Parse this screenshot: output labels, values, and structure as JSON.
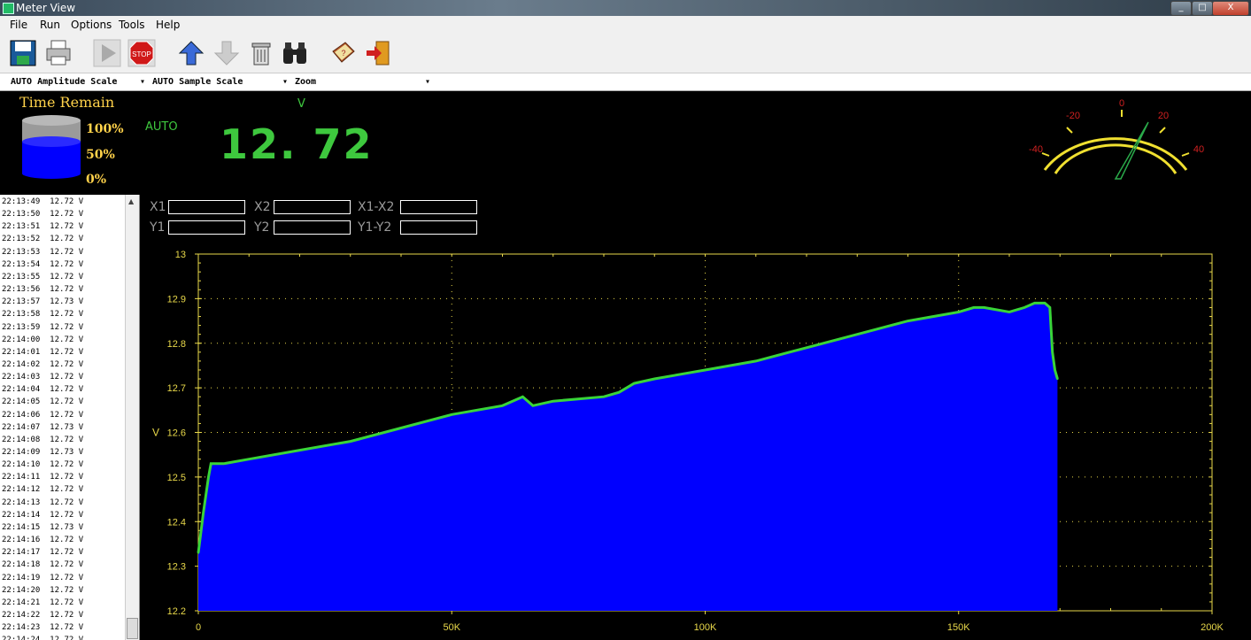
{
  "window": {
    "title": "Meter View",
    "min": "_",
    "max": "□",
    "close": "X"
  },
  "menu": [
    "File",
    "Run",
    "Options",
    "Tools",
    "Help"
  ],
  "toolbar": {
    "buttons": [
      "save-icon",
      "print-icon",
      "play-icon",
      "stop-icon",
      "scroll-up-icon",
      "scroll-down-icon",
      "trash-icon",
      "binoculars-icon",
      "help-book-icon",
      "exit-icon"
    ],
    "stop_label": "STOP"
  },
  "combos": {
    "amplitude": "AUTO Amplitude Scale",
    "sample": "AUTO Sample Scale",
    "zoom": "Zoom"
  },
  "panel": {
    "time_remain_label": "Time Remain",
    "pct_100": "100%",
    "pct_50": "50%",
    "pct_0": "0%",
    "auto": "AUTO",
    "unit": "V",
    "reading": "12. 72",
    "time_remain_fraction": 0.6
  },
  "gauge": {
    "ticks": [
      "-40",
      "-20",
      "0",
      "20",
      "40"
    ],
    "needle_value": 12.72
  },
  "log": [
    "22:13:49  12.72 V",
    "22:13:50  12.72 V",
    "22:13:51  12.72 V",
    "22:13:52  12.72 V",
    "22:13:53  12.72 V",
    "22:13:54  12.72 V",
    "22:13:55  12.72 V",
    "22:13:56  12.72 V",
    "22:13:57  12.73 V",
    "22:13:58  12.72 V",
    "22:13:59  12.72 V",
    "22:14:00  12.72 V",
    "22:14:01  12.72 V",
    "22:14:02  12.72 V",
    "22:14:03  12.72 V",
    "22:14:04  12.72 V",
    "22:14:05  12.72 V",
    "22:14:06  12.72 V",
    "22:14:07  12.73 V",
    "22:14:08  12.72 V",
    "22:14:09  12.73 V",
    "22:14:10  12.72 V",
    "22:14:11  12.72 V",
    "22:14:12  12.72 V",
    "22:14:13  12.72 V",
    "22:14:14  12.72 V",
    "22:14:15  12.73 V",
    "22:14:16  12.72 V",
    "22:14:17  12.72 V",
    "22:14:18  12.72 V",
    "22:14:19  12.72 V",
    "22:14:20  12.72 V",
    "22:14:21  12.72 V",
    "22:14:22  12.72 V",
    "22:14:23  12.72 V",
    "22:14:24  12.72 V"
  ],
  "cursors": {
    "x1": "X1",
    "x2": "X2",
    "dx": "X1-X2",
    "y1": "Y1",
    "y2": "Y2",
    "dy": "Y1-Y2"
  },
  "colors": {
    "trace": "#39d439",
    "fill": "#0000ff",
    "axis": "#e8d84a",
    "digits": "#3ec83e",
    "labels": "#ffd24a"
  },
  "chart_data": {
    "type": "area",
    "ylabel": "V",
    "xlabel": "Sample Number",
    "ylim": [
      12.2,
      13
    ],
    "xlim": [
      0,
      200000
    ],
    "yticks": [
      "13",
      "12.9",
      "12.8",
      "12.7",
      "12.6",
      "12.5",
      "12.4",
      "12.3",
      "12.2"
    ],
    "xticks": [
      "0",
      "50K",
      "100K",
      "150K",
      "200K"
    ],
    "grid": true,
    "x": [
      0,
      1000,
      2000,
      2500,
      5000,
      10000,
      20000,
      30000,
      40000,
      50000,
      60000,
      64000,
      66000,
      70000,
      80000,
      83000,
      86000,
      90000,
      100000,
      110000,
      120000,
      130000,
      140000,
      150000,
      153000,
      155000,
      160000,
      163000,
      165000,
      167000,
      168000,
      168500,
      169000,
      169500
    ],
    "y": [
      12.33,
      12.42,
      12.5,
      12.53,
      12.53,
      12.54,
      12.56,
      12.58,
      12.61,
      12.64,
      12.66,
      12.68,
      12.66,
      12.67,
      12.68,
      12.69,
      12.71,
      12.72,
      12.74,
      12.76,
      12.79,
      12.82,
      12.85,
      12.87,
      12.88,
      12.88,
      12.87,
      12.88,
      12.89,
      12.89,
      12.88,
      12.78,
      12.74,
      12.72
    ]
  }
}
